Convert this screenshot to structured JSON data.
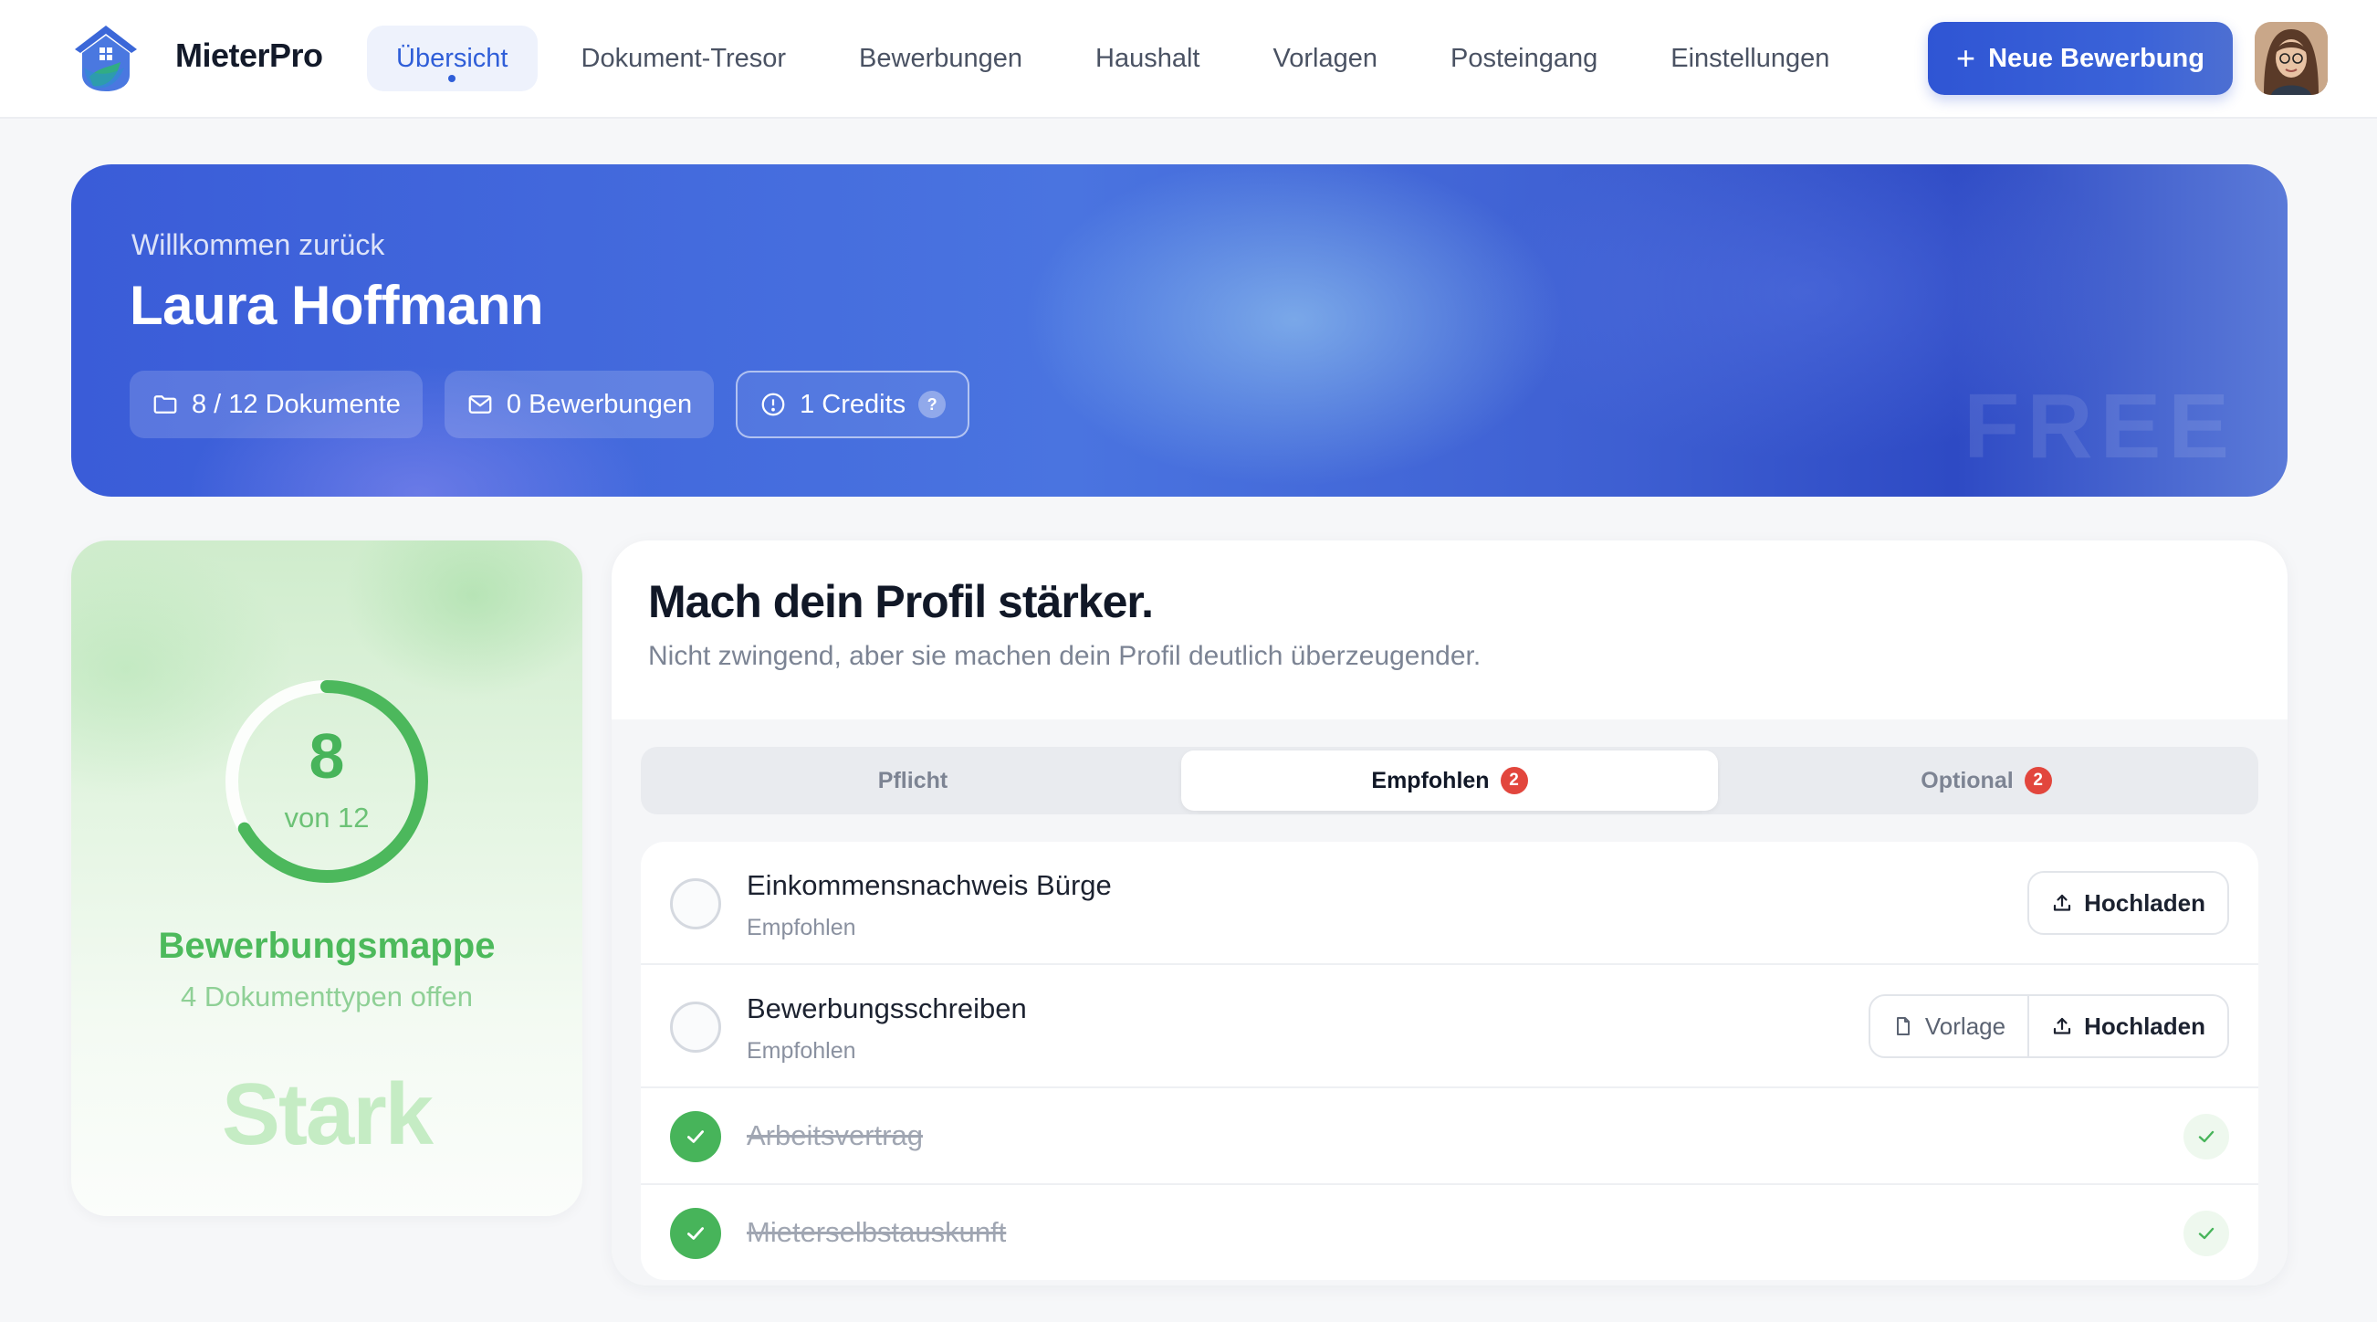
{
  "app": {
    "brand": "MieterPro"
  },
  "nav": {
    "items": [
      {
        "label": "Übersicht",
        "active": true
      },
      {
        "label": "Dokument-Tresor"
      },
      {
        "label": "Bewerbungen"
      },
      {
        "label": "Haushalt"
      },
      {
        "label": "Vorlagen"
      },
      {
        "label": "Posteingang"
      },
      {
        "label": "Einstellungen"
      }
    ],
    "new_button": "Neue Bewerbung"
  },
  "hero": {
    "welcome": "Willkommen zurück",
    "name": "Laura Hoffmann",
    "documents": "8 / 12 Dokumente",
    "applications": "0 Bewerbungen",
    "credits": "1 Credits",
    "help": "?",
    "plan": "FREE"
  },
  "score": {
    "value": "8",
    "of": "von 12",
    "progress": 0.667,
    "title": "Bewerbungsmappe",
    "open": "4 Dokumenttypen offen",
    "level": "Stark"
  },
  "profile": {
    "title": "Mach dein Profil stärker.",
    "subtitle": "Nicht zwingend, aber sie machen dein Profil deutlich überzeugender.",
    "tabs": [
      {
        "label": "Pflicht",
        "badge": ""
      },
      {
        "label": "Empfohlen",
        "badge": "2",
        "active": true
      },
      {
        "label": "Optional",
        "badge": "2"
      }
    ],
    "items": [
      {
        "title": "Einkommensnachweis Bürge",
        "category": "Empfohlen",
        "upload": "Hochladen"
      },
      {
        "title": "Bewerbungsschreiben",
        "category": "Empfohlen",
        "template": "Vorlage",
        "upload": "Hochladen"
      },
      {
        "title": "Arbeitsvertrag",
        "done": true
      },
      {
        "title": "Mieterselbstauskunft",
        "done": true
      }
    ]
  },
  "colors": {
    "primary": "#2f55d4",
    "success": "#47b45a",
    "badge": "#e2463d"
  }
}
